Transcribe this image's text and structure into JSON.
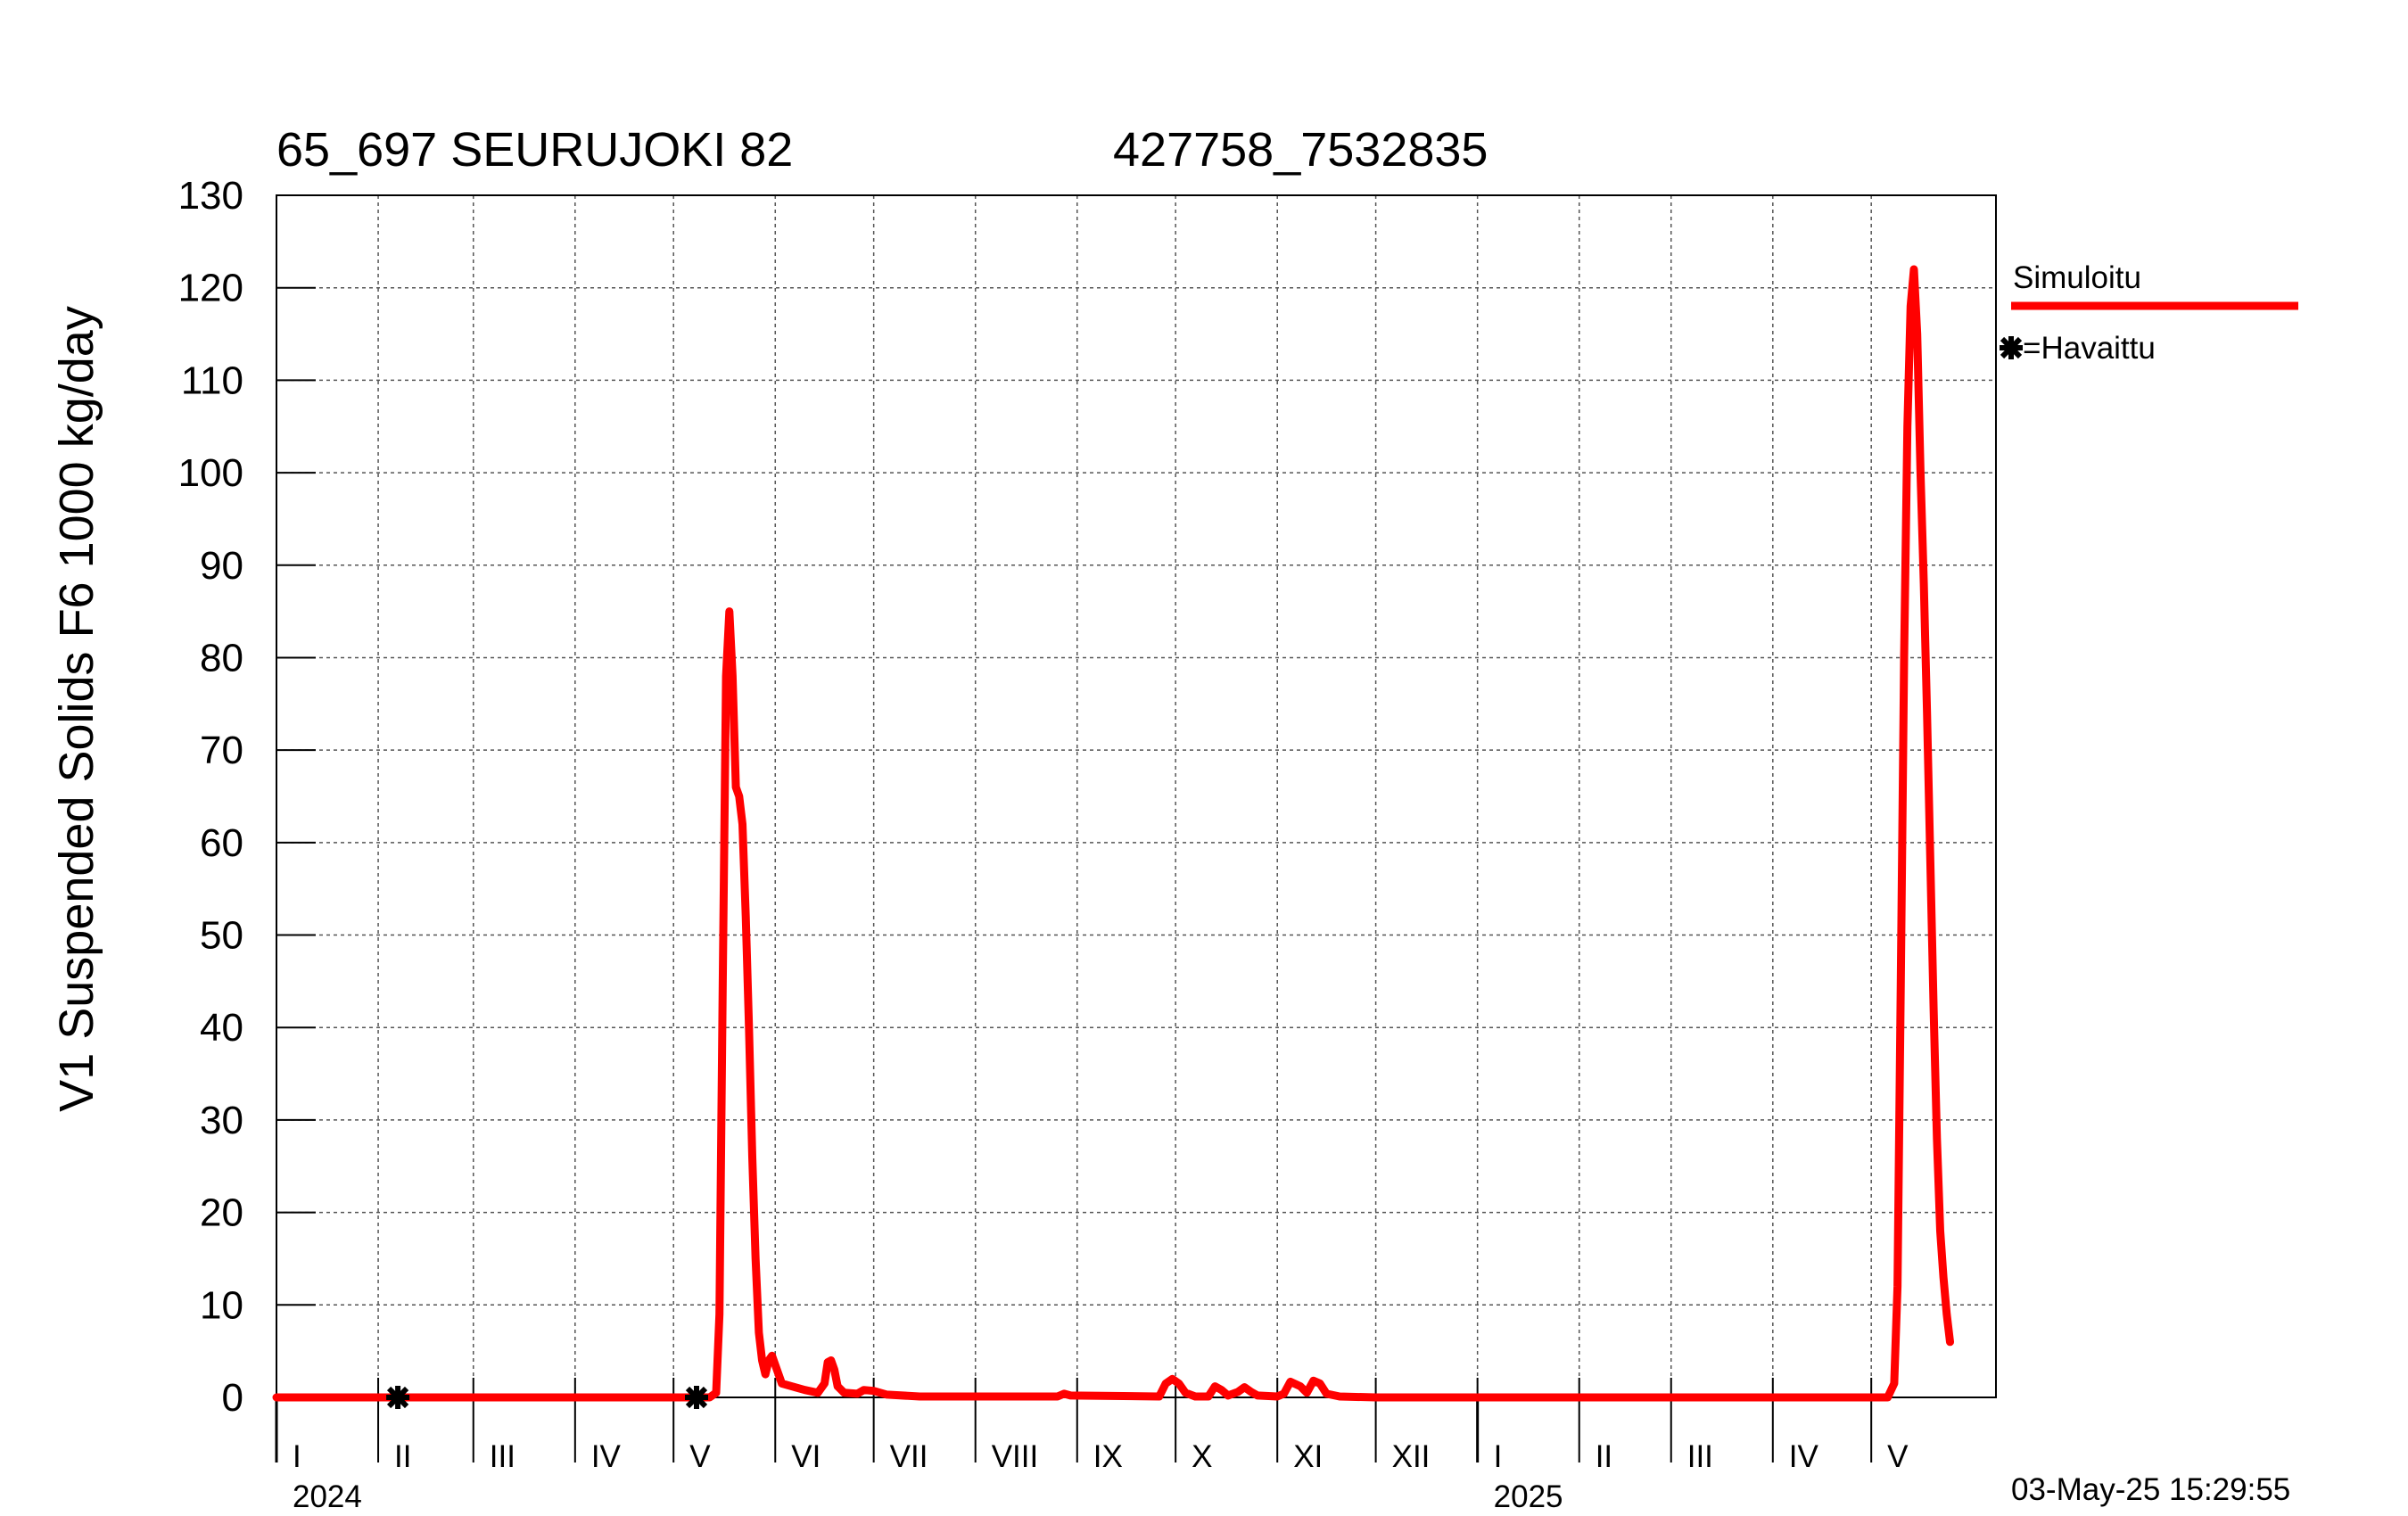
{
  "header": {
    "station": "65_697 SEURUJOKI 82",
    "coords": "427758_7532835",
    "timestamp": "03-May-25 15:29:55"
  },
  "chart_data": {
    "type": "line",
    "ylabel": "V1 Suspended Solids F6 1000 kg/day",
    "ylim": [
      0,
      130
    ],
    "yticks": [
      "0",
      "10",
      "20",
      "30",
      "40",
      "50",
      "60",
      "70",
      "80",
      "90",
      "100",
      "110",
      "120",
      "130"
    ],
    "xlim": [
      "2024-01-01",
      "2025-06-08"
    ],
    "grid": true,
    "legend_position": "right",
    "months": [
      "I",
      "II",
      "III",
      "IV",
      "V",
      "VI",
      "VII",
      "VIII",
      "IX",
      "X",
      "XI",
      "XII",
      "I",
      "II",
      "III",
      "IV",
      "V"
    ],
    "month_starts": [
      "2024-01-01",
      "2024-02-01",
      "2024-03-01",
      "2024-04-01",
      "2024-05-01",
      "2024-06-01",
      "2024-07-01",
      "2024-08-01",
      "2024-09-01",
      "2024-10-01",
      "2024-11-01",
      "2024-12-01",
      "2025-01-01",
      "2025-02-01",
      "2025-03-01",
      "2025-04-01",
      "2025-05-01"
    ],
    "years": [
      {
        "label": "2024",
        "date": "2024-01-01"
      },
      {
        "label": "2025",
        "date": "2025-01-01"
      }
    ],
    "series": [
      {
        "name": "Simuloitu",
        "color": "#ff0000",
        "style": "line",
        "points": [
          [
            "2024-01-01",
            0
          ],
          [
            "2024-05-12",
            0
          ],
          [
            "2024-05-14",
            0.5
          ],
          [
            "2024-05-15",
            9
          ],
          [
            "2024-05-16",
            45
          ],
          [
            "2024-05-17",
            78
          ],
          [
            "2024-05-18",
            85
          ],
          [
            "2024-05-19",
            78
          ],
          [
            "2024-05-20",
            66
          ],
          [
            "2024-05-21",
            65
          ],
          [
            "2024-05-22",
            62
          ],
          [
            "2024-05-23",
            52
          ],
          [
            "2024-05-24",
            40
          ],
          [
            "2024-05-25",
            26
          ],
          [
            "2024-05-26",
            15
          ],
          [
            "2024-05-27",
            7
          ],
          [
            "2024-05-28",
            4
          ],
          [
            "2024-05-29",
            2.5
          ],
          [
            "2024-05-30",
            4
          ],
          [
            "2024-05-31",
            4.5
          ],
          [
            "2024-06-01",
            3.5
          ],
          [
            "2024-06-03",
            1.5
          ],
          [
            "2024-06-06",
            1.2
          ],
          [
            "2024-06-10",
            0.8
          ],
          [
            "2024-06-14",
            0.5
          ],
          [
            "2024-06-16",
            1.5
          ],
          [
            "2024-06-17",
            3.8
          ],
          [
            "2024-06-18",
            4
          ],
          [
            "2024-06-19",
            3
          ],
          [
            "2024-06-20",
            1.2
          ],
          [
            "2024-06-22",
            0.5
          ],
          [
            "2024-06-26",
            0.4
          ],
          [
            "2024-06-28",
            0.8
          ],
          [
            "2024-07-01",
            0.7
          ],
          [
            "2024-07-05",
            0.3
          ],
          [
            "2024-07-15",
            0.1
          ],
          [
            "2024-08-01",
            0.1
          ],
          [
            "2024-08-26",
            0.1
          ],
          [
            "2024-08-28",
            0.4
          ],
          [
            "2024-08-30",
            0.2
          ],
          [
            "2024-09-26",
            0.1
          ],
          [
            "2024-09-28",
            1.5
          ],
          [
            "2024-09-30",
            2
          ],
          [
            "2024-10-02",
            1.5
          ],
          [
            "2024-10-04",
            0.5
          ],
          [
            "2024-10-07",
            0.1
          ],
          [
            "2024-10-11",
            0.1
          ],
          [
            "2024-10-13",
            1.2
          ],
          [
            "2024-10-15",
            0.8
          ],
          [
            "2024-10-17",
            0.2
          ],
          [
            "2024-10-20",
            0.6
          ],
          [
            "2024-10-22",
            1.1
          ],
          [
            "2024-10-24",
            0.6
          ],
          [
            "2024-10-26",
            0.2
          ],
          [
            "2024-11-01",
            0.1
          ],
          [
            "2024-11-03",
            0.4
          ],
          [
            "2024-11-05",
            1.7
          ],
          [
            "2024-11-08",
            1.2
          ],
          [
            "2024-11-10",
            0.5
          ],
          [
            "2024-11-12",
            1.8
          ],
          [
            "2024-11-14",
            1.5
          ],
          [
            "2024-11-16",
            0.4
          ],
          [
            "2024-11-20",
            0.1
          ],
          [
            "2024-12-01",
            0
          ],
          [
            "2025-05-06",
            0
          ],
          [
            "2025-05-08",
            1.5
          ],
          [
            "2025-05-09",
            12
          ],
          [
            "2025-05-10",
            45
          ],
          [
            "2025-05-11",
            80
          ],
          [
            "2025-05-12",
            105
          ],
          [
            "2025-05-13",
            118
          ],
          [
            "2025-05-14",
            122
          ],
          [
            "2025-05-15",
            115
          ],
          [
            "2025-05-16",
            100
          ],
          [
            "2025-05-17",
            88
          ],
          [
            "2025-05-18",
            74
          ],
          [
            "2025-05-19",
            58
          ],
          [
            "2025-05-20",
            42
          ],
          [
            "2025-05-21",
            28
          ],
          [
            "2025-05-22",
            18
          ],
          [
            "2025-05-23",
            13
          ],
          [
            "2025-05-24",
            9
          ],
          [
            "2025-05-25",
            6
          ]
        ]
      },
      {
        "name": "Havaittu",
        "color": "#000000",
        "style": "marker",
        "marker": "asterisk",
        "points": [
          [
            "2024-02-07",
            0
          ],
          [
            "2024-05-08",
            0
          ]
        ]
      }
    ]
  }
}
